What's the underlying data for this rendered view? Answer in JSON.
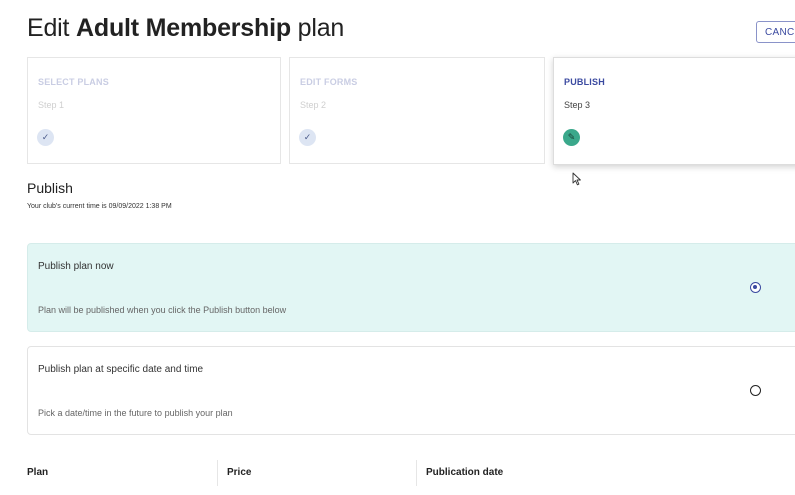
{
  "header": {
    "title_prefix": "Edit ",
    "title_bold": "Adult Membership",
    "title_suffix": " plan",
    "cancel_label": "CANCEL"
  },
  "steps": [
    {
      "name": "SELECT PLANS",
      "sub": "Step 1",
      "icon": "check-icon",
      "glyph": "✓"
    },
    {
      "name": "EDIT FORMS",
      "sub": "Step 2",
      "icon": "check-icon",
      "glyph": "✓"
    },
    {
      "name": "PUBLISH",
      "sub": "Step 3",
      "icon": "pencil-icon",
      "glyph": "✎"
    }
  ],
  "publish": {
    "title": "Publish",
    "subtitle": "Your club's current time is 09/09/2022 1:38 PM"
  },
  "options": [
    {
      "title": "Publish plan now",
      "desc": "Plan will be published when you click the Publish button below",
      "selected": true
    },
    {
      "title": "Publish plan at specific date and time",
      "desc": "Pick a date/time in the future to publish your plan",
      "selected": false
    }
  ],
  "table": {
    "headers": [
      "Plan",
      "Price",
      "Publication date"
    ]
  },
  "colors": {
    "accent": "#3b4aa0",
    "selected_bg": "#e2f6f4",
    "active_step_icon": "#3aa88b"
  }
}
